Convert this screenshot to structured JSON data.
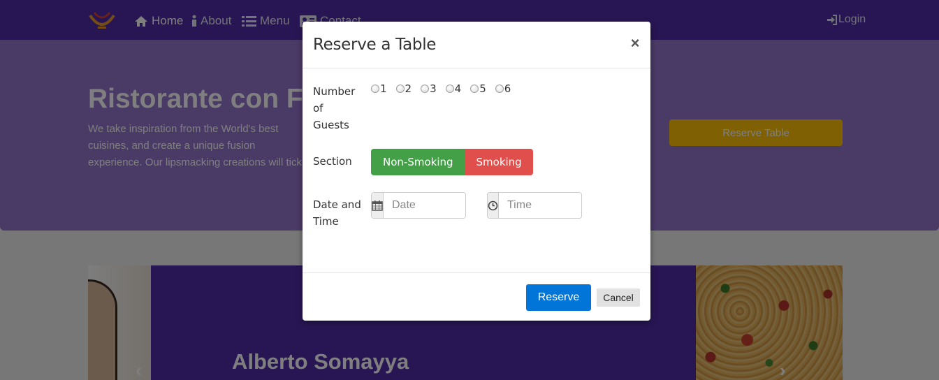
{
  "navbar": {
    "items": [
      {
        "label": "Home",
        "icon": "home-icon",
        "active": true
      },
      {
        "label": "About",
        "icon": "info-icon"
      },
      {
        "label": "Menu",
        "icon": "list-icon"
      },
      {
        "label": "Contact",
        "icon": "address-card-icon"
      }
    ],
    "login_label": "Login",
    "bg_color": "#512da8"
  },
  "hero": {
    "title": "Ristorante con Fusion",
    "text": "We take inspiration from the World's best cuisines, and create a unique fusion experience. Our lipsmacking creations will tickle your culinary senses!",
    "reserve_button": "Reserve Table",
    "bg_color": "#9575cd",
    "button_color": "#ffc107"
  },
  "carousel": {
    "caption": "Alberto Somayya",
    "prev_glyph": "‹",
    "next_glyph": "›"
  },
  "modal": {
    "title": "Reserve a Table",
    "close_glyph": "×",
    "guests_label": "Number of Guests",
    "guest_options": [
      "1",
      "2",
      "3",
      "4",
      "5",
      "6"
    ],
    "section_label": "Section",
    "section_options": [
      {
        "label": "Non-Smoking",
        "color": "#43a047"
      },
      {
        "label": "Smoking",
        "color": "#e04f4c"
      }
    ],
    "datetime_label": "Date and Time",
    "date_placeholder": "Date",
    "time_placeholder": "Time",
    "reserve_label": "Reserve",
    "cancel_label": "Cancel",
    "reserve_color": "#0275d8"
  }
}
